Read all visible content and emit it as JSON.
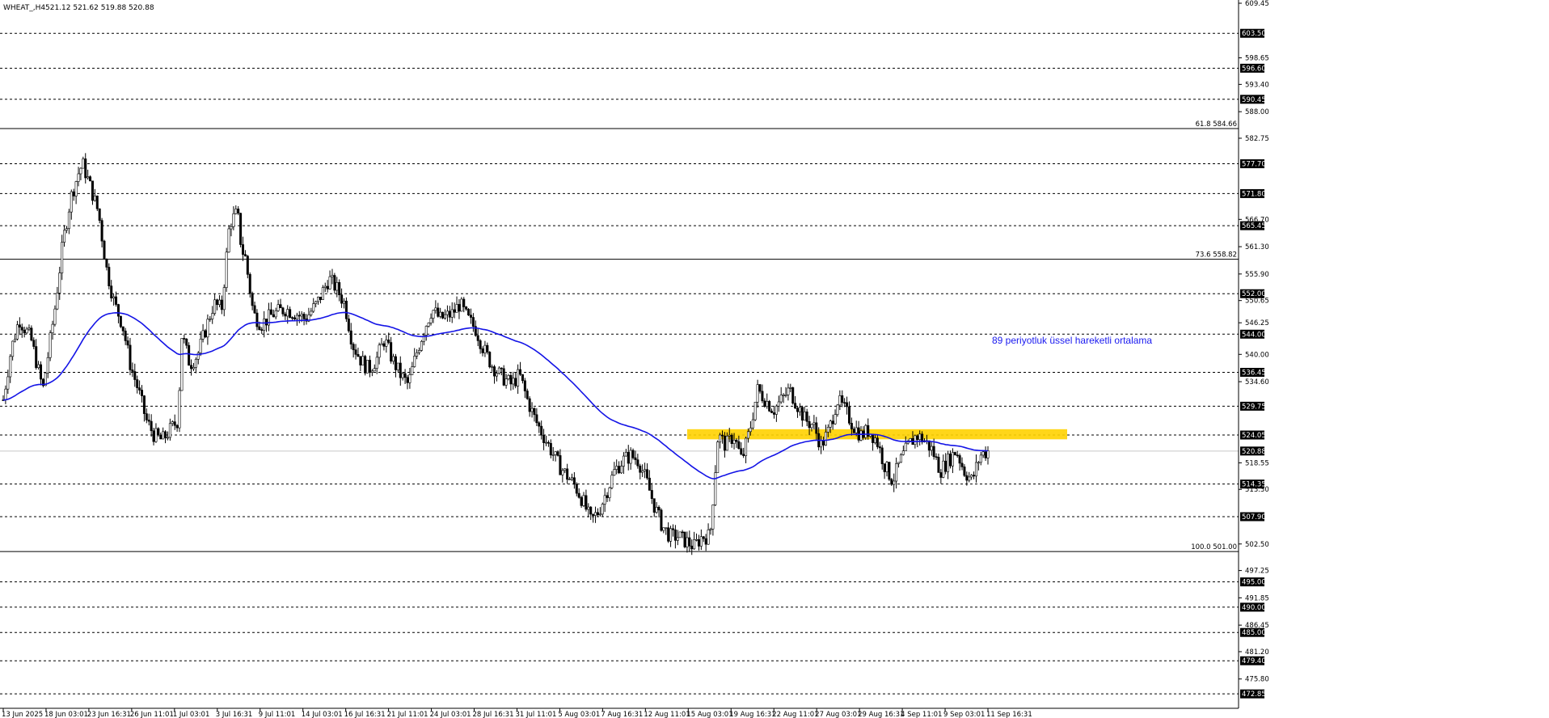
{
  "header": {
    "symbol": "WHEAT_,H4",
    "ohlc": "521.12 521.62 519.88 520.88"
  },
  "chart_data": {
    "type": "candlestick",
    "instrument": "WHEAT_",
    "timeframe": "H4",
    "ylim": [
      470.0,
      609.45
    ],
    "y_tick_labels": [
      "609.45",
      "603.50",
      "598.65",
      "596.60",
      "593.40",
      "590.45",
      "588.00",
      "582.75",
      "577.70",
      "571.80",
      "566.70",
      "565.45",
      "561.30",
      "555.90",
      "552.00",
      "550.65",
      "546.25",
      "544.00",
      "540.00",
      "536.45",
      "534.60",
      "529.75",
      "524.05",
      "520.88",
      "518.55",
      "514.35",
      "513.30",
      "507.90",
      "502.50",
      "497.25",
      "495.00",
      "491.85",
      "490.00",
      "486.45",
      "485.00",
      "481.20",
      "479.40",
      "475.80",
      "472.85"
    ],
    "x_tick_labels": [
      "13 Jun 2025",
      "18 Jun 03:01",
      "23 Jun 16:31",
      "26 Jun 11:01",
      "1 Jul 03:01",
      "3 Jul 16:31",
      "9 Jul 11:01",
      "14 Jul 03:01",
      "16 Jul 16:31",
      "21 Jul 11:01",
      "24 Jul 03:01",
      "28 Jul 16:31",
      "31 Jul 11:01",
      "5 Aug 03:01",
      "7 Aug 16:31",
      "12 Aug 11:01",
      "15 Aug 03:01",
      "19 Aug 16:31",
      "22 Aug 11:01",
      "27 Aug 03:01",
      "29 Aug 16:31",
      "4 Sep 11:01",
      "9 Sep 03:01",
      "11 Sep 16:31"
    ],
    "horizontal_levels": [
      603.5,
      596.6,
      590.45,
      577.7,
      571.8,
      565.45,
      552.0,
      544.0,
      536.45,
      529.75,
      524.05,
      514.35,
      507.9,
      495.0,
      490.0,
      485.0,
      479.4,
      472.85
    ],
    "level_labels": [
      "603.50",
      "596.60",
      "590.45",
      "577.70",
      "571.80",
      "565.45",
      "552.00",
      "544.00",
      "536.45",
      "529.75",
      "524.05",
      "514.35",
      "507.90",
      "495.00",
      "490.00",
      "485.00",
      "479.40",
      "472.85"
    ],
    "current_price": 520.88,
    "current_price_label": "520.88",
    "fibonacci_levels": [
      {
        "label": "61.8 584.66",
        "value": 584.66
      },
      {
        "label": "73.6 558.82",
        "value": 558.82
      },
      {
        "label": "100.0 501.00",
        "value": 501.0
      }
    ],
    "highlight_zone": {
      "low": 523.2,
      "high": 525.2
    },
    "ema_label": "89 periyotluk üssel hareketli ortalama",
    "price_path": [
      [
        0,
        531
      ],
      [
        2,
        541
      ],
      [
        4,
        547
      ],
      [
        7,
        543
      ],
      [
        10,
        533
      ],
      [
        13,
        549
      ],
      [
        15,
        562
      ],
      [
        17,
        571
      ],
      [
        19,
        576
      ],
      [
        20,
        577.7
      ],
      [
        22,
        573
      ],
      [
        24,
        568
      ],
      [
        26,
        557
      ],
      [
        28,
        550
      ],
      [
        30,
        546
      ],
      [
        32,
        538
      ],
      [
        34,
        533
      ],
      [
        35,
        530
      ],
      [
        36,
        527
      ],
      [
        38,
        524
      ],
      [
        40,
        523
      ],
      [
        42,
        525
      ],
      [
        44,
        527
      ],
      [
        45,
        544
      ],
      [
        47,
        538
      ],
      [
        49,
        540
      ],
      [
        51,
        545
      ],
      [
        53,
        550
      ],
      [
        55,
        549
      ],
      [
        57,
        566
      ],
      [
        59,
        568
      ],
      [
        60,
        561
      ],
      [
        61,
        559
      ],
      [
        63,
        548
      ],
      [
        65,
        546
      ],
      [
        68,
        548
      ],
      [
        71,
        549
      ],
      [
        74,
        548
      ],
      [
        76,
        547
      ],
      [
        79,
        550
      ],
      [
        82,
        555
      ],
      [
        84,
        553
      ],
      [
        86,
        550
      ],
      [
        88,
        542
      ],
      [
        90,
        539
      ],
      [
        92,
        537
      ],
      [
        94,
        539
      ],
      [
        96,
        543
      ],
      [
        98,
        539
      ],
      [
        100,
        536
      ],
      [
        102,
        534
      ],
      [
        104,
        540
      ],
      [
        106,
        545
      ],
      [
        108,
        549
      ],
      [
        110,
        547
      ],
      [
        113,
        548
      ],
      [
        115,
        550
      ],
      [
        117,
        547
      ],
      [
        119,
        545
      ],
      [
        121,
        541
      ],
      [
        123,
        538
      ],
      [
        125,
        536
      ],
      [
        128,
        534
      ],
      [
        130,
        536
      ],
      [
        132,
        531
      ],
      [
        134,
        527
      ],
      [
        136,
        524
      ],
      [
        138,
        521
      ],
      [
        140,
        518
      ],
      [
        142,
        516
      ],
      [
        144,
        514
      ],
      [
        146,
        511
      ],
      [
        148,
        507
      ],
      [
        150,
        509
      ],
      [
        152,
        513
      ],
      [
        154,
        517
      ],
      [
        156,
        519
      ],
      [
        158,
        520
      ],
      [
        160,
        519
      ],
      [
        162,
        515
      ],
      [
        164,
        510
      ],
      [
        166,
        506
      ],
      [
        168,
        504
      ],
      [
        170,
        504
      ],
      [
        172,
        503
      ],
      [
        174,
        502
      ],
      [
        176,
        504
      ],
      [
        178,
        504
      ],
      [
        180,
        524
      ],
      [
        182,
        522
      ],
      [
        184,
        524
      ],
      [
        186,
        519
      ],
      [
        188,
        525
      ],
      [
        190,
        533
      ],
      [
        192,
        531
      ],
      [
        194,
        529
      ],
      [
        196,
        531
      ],
      [
        198,
        533
      ],
      [
        200,
        530
      ],
      [
        202,
        527
      ],
      [
        204,
        526
      ],
      [
        206,
        522
      ],
      [
        208,
        525
      ],
      [
        210,
        531
      ],
      [
        212,
        529
      ],
      [
        214,
        526
      ],
      [
        216,
        524
      ],
      [
        218,
        525
      ],
      [
        220,
        523
      ],
      [
        222,
        518
      ],
      [
        224,
        515
      ],
      [
        226,
        519
      ],
      [
        228,
        522
      ],
      [
        230,
        524
      ],
      [
        232,
        523
      ],
      [
        234,
        521
      ],
      [
        236,
        517
      ],
      [
        238,
        519
      ],
      [
        240,
        521
      ],
      [
        242,
        517
      ],
      [
        244,
        515
      ],
      [
        246,
        520
      ],
      [
        248,
        520.88
      ]
    ]
  }
}
